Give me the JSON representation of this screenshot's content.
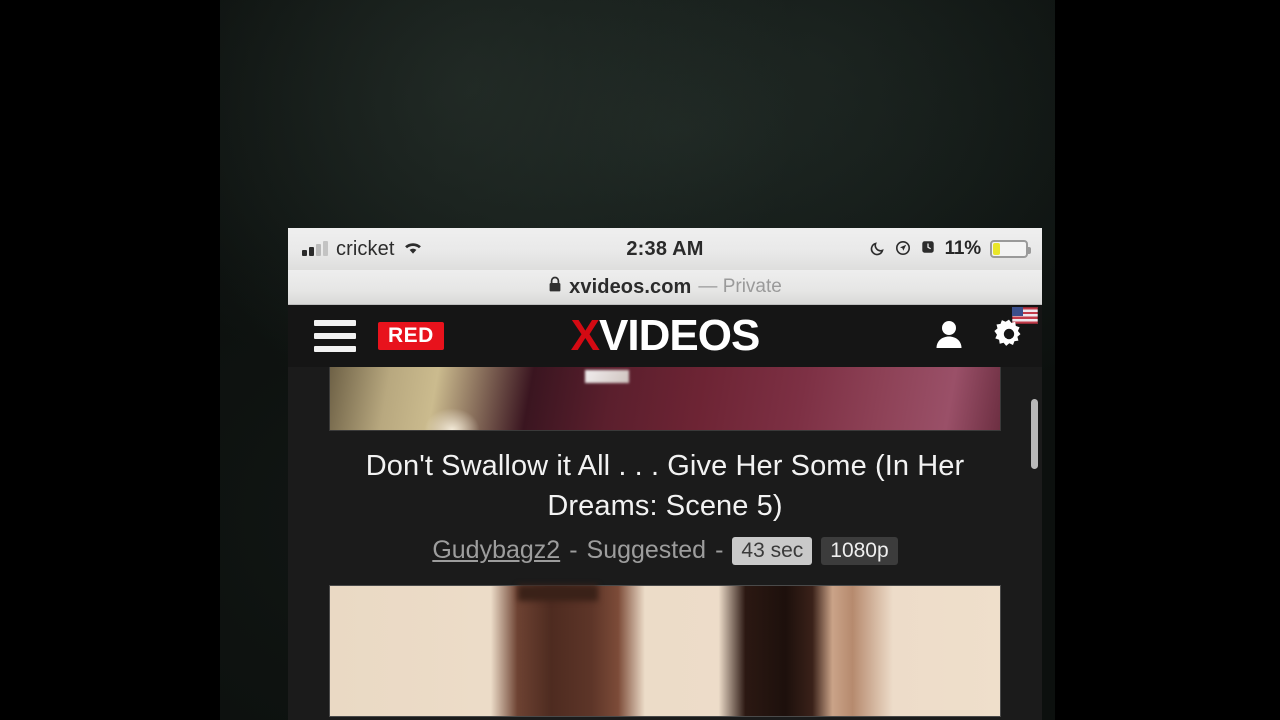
{
  "statusbar": {
    "carrier": "cricket",
    "signal_icon": "cellular-signal-icon",
    "wifi_icon": "wifi-icon",
    "time": "2:38 AM",
    "moon_icon": "do-not-disturb-moon-icon",
    "location_icon": "location-arrow-icon",
    "alarm_icon": "alarm-clock-icon",
    "battery_percent": "11%",
    "battery_level": 11,
    "battery_color": "#e9e629"
  },
  "urlbar": {
    "lock_icon": "lock-icon",
    "host": "xvideos.com",
    "private_label": "— Private"
  },
  "siteheader": {
    "menu_icon": "hamburger-menu-icon",
    "red_label": "RED",
    "logo_x": "X",
    "logo_rest": "VIDEOS",
    "account_icon": "user-account-icon",
    "settings_icon": "gear-settings-icon",
    "flag_icon": "us-flag-icon",
    "background": "#151515",
    "accent": "#d40a13"
  },
  "content": {
    "video": {
      "title": "Don't Swallow it All . . . Give Her Some (In Her Dreams: Scene 5)",
      "uploader": "Gudybagz2",
      "separator_1": "-",
      "suggested_label": "Suggested",
      "separator_2": "-",
      "duration": "43 sec",
      "quality": "1080p"
    },
    "thumbnail_top": "video-thumbnail-partial",
    "thumbnail_bottom": "video-thumbnail-next"
  }
}
